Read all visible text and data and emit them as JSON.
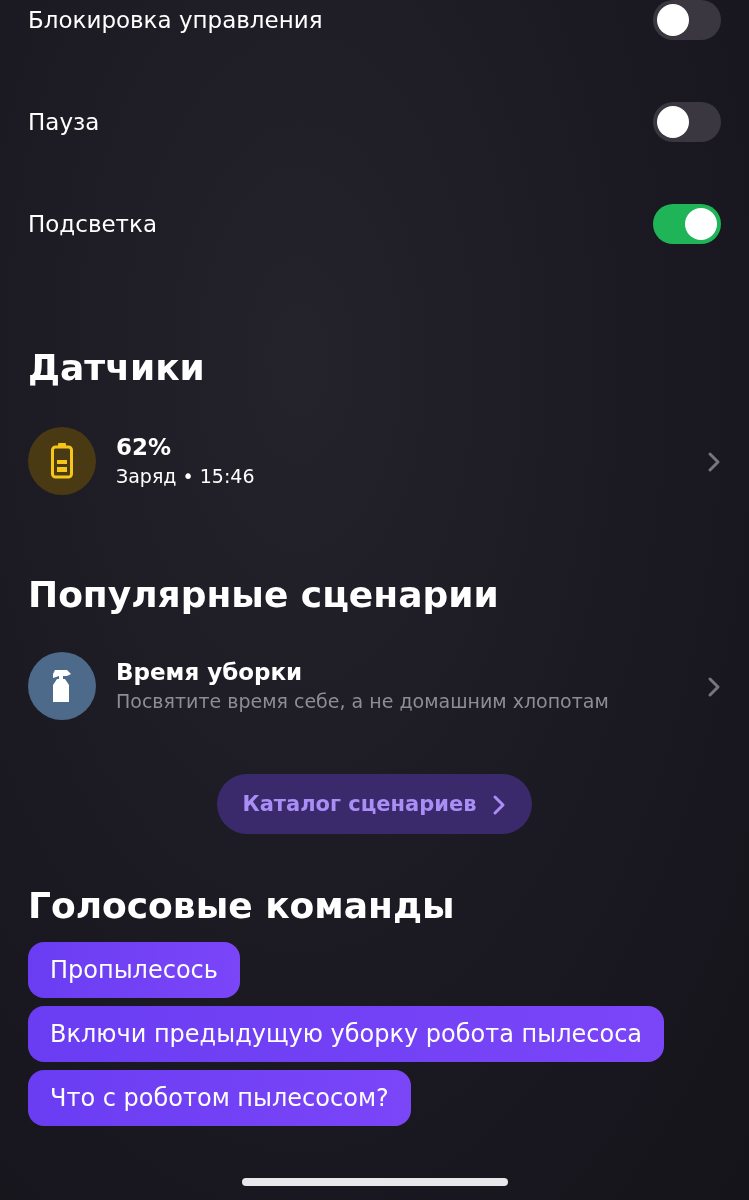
{
  "toggles": [
    {
      "label": "Блокировка управления",
      "on": false
    },
    {
      "label": "Пауза",
      "on": false
    },
    {
      "label": "Подсветка",
      "on": true
    }
  ],
  "sensors": {
    "title": "Датчики",
    "items": [
      {
        "value": "62%",
        "subtitle": "Заряд • 15:46"
      }
    ]
  },
  "scenarios": {
    "title": "Популярные сценарии",
    "items": [
      {
        "title": "Время уборки",
        "description": "Посвятите время себе, а не домашним хлопотам"
      }
    ],
    "catalog_button": "Каталог сценариев"
  },
  "voice_commands": {
    "title": "Голосовые команды",
    "items": [
      "Пропылесось",
      "Включи предыдущую уборку робота пылесоса",
      "Что с роботом пылесосом?"
    ]
  }
}
